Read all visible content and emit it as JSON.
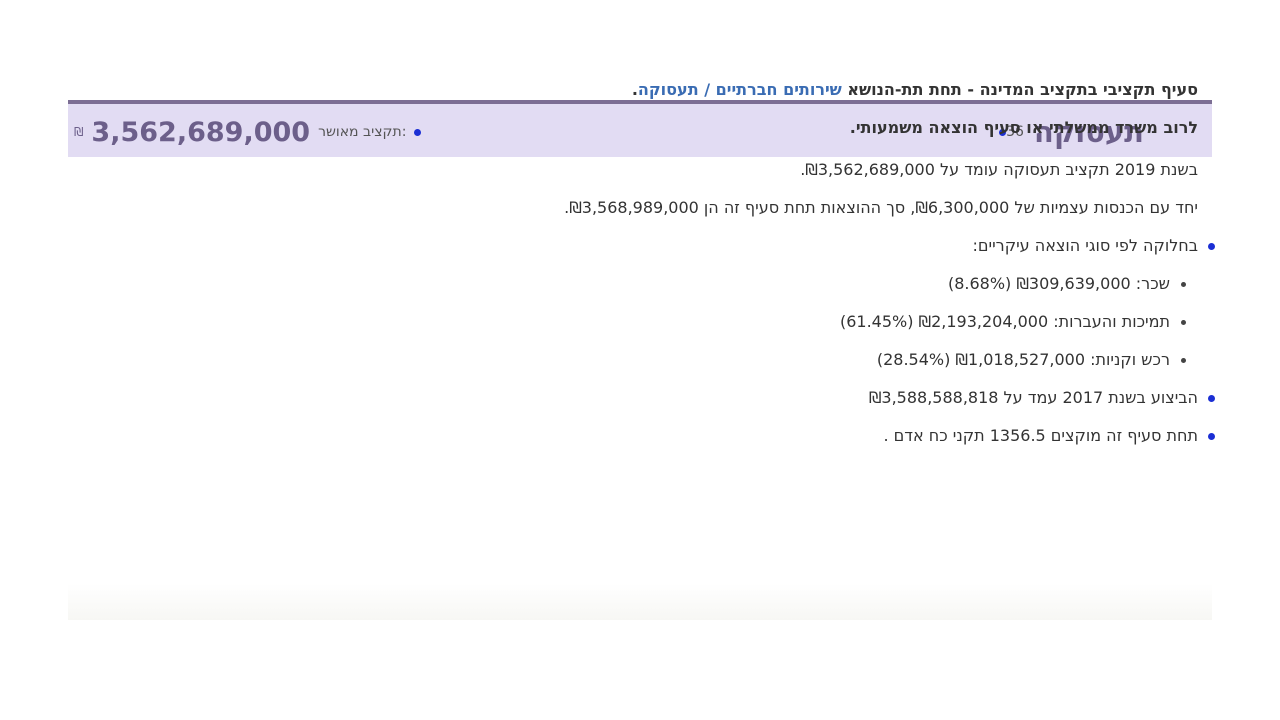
{
  "header": {
    "page_number": "36",
    "section_title": "תעסוקה",
    "budget_label": "תקציב מאושר:",
    "budget_amount": "3,562,689,000",
    "currency_symbol": "₪"
  },
  "intro": {
    "line1_prefix": "סעיף תקציבי בתקציב המדינה - תחת תת-הנושא ",
    "line1_subject": "שירותים חברתיים / תעסוקה",
    "line1_suffix": ".",
    "line2": "לרוב משרד ממשלתי או סעיף הוצאה משמעותי."
  },
  "paragraphs": {
    "budget_2019": "בשנת 2019 תקציב תעסוקה עומד על ₪3,562,689,000.",
    "with_income": "יחד עם הכנסות עצמיות של ₪6,300,000, סך ההוצאות תחת סעיף זה הן ₪3,568,989,000."
  },
  "bullets": {
    "breakdown_title": "בחלוקה לפי סוגי הוצאה עיקריים:",
    "breakdown": [
      {
        "text": "שכר: ₪309,639,000 (8.68%)"
      },
      {
        "text": "תמיכות והעברות: ₪2,193,204,000 (61.45%)"
      },
      {
        "text": "רכש וקניות: ₪1,018,527,000 (28.54%)"
      }
    ],
    "execution_2017": "הביצוע בשנת 2017 עמד על ₪3,588,588,818",
    "headcount": "תחת סעיף זה מוקצים 1356.5 תקני כח אדם ."
  },
  "colors": {
    "header_bg": "#e2dcf3",
    "header_border": "#7c6e94",
    "title": "#6c5f8a",
    "accent_dot": "#1b2fd4",
    "link": "#3a6cb3"
  }
}
